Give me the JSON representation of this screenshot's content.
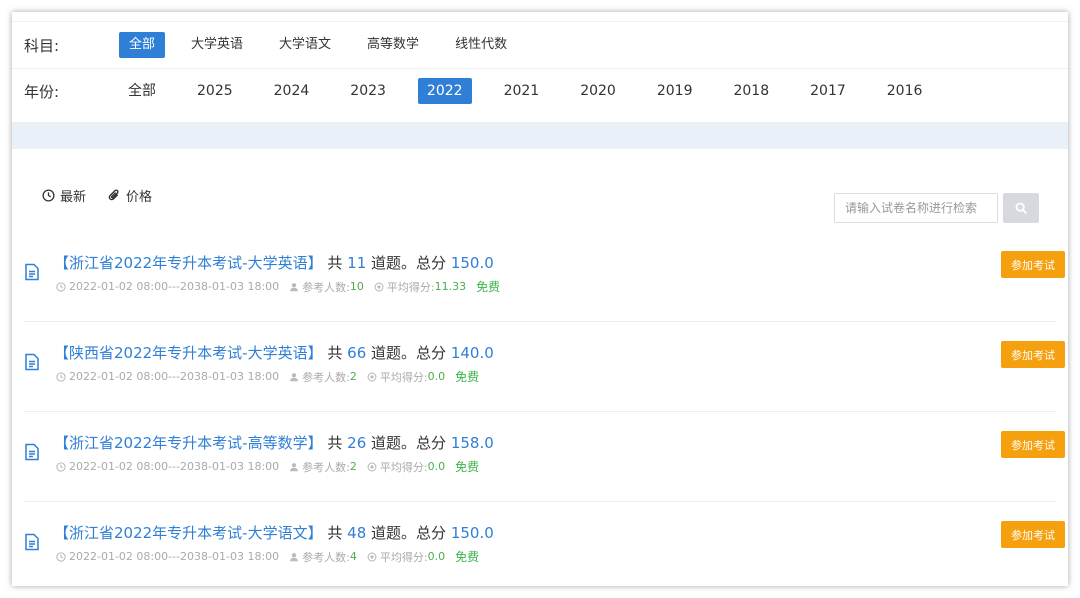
{
  "filters": {
    "subject": {
      "label": "科目:",
      "options": [
        "全部",
        "大学英语",
        "大学语文",
        "高等数学",
        "线性代数"
      ],
      "active_index": 0
    },
    "year": {
      "label": "年份:",
      "options": [
        "全部",
        "2025",
        "2024",
        "2023",
        "2022",
        "2021",
        "2020",
        "2019",
        "2018",
        "2017",
        "2016"
      ],
      "active_index": 4
    }
  },
  "sort": {
    "newest": "最新",
    "price": "价格"
  },
  "search": {
    "placeholder": "请输入试卷名称进行检索"
  },
  "exams": [
    {
      "title": "【浙江省2022年专升本考试-大学英语】",
      "gong": "共",
      "count": "11",
      "count_suffix": "道题。总分",
      "score": "150.0",
      "time": "2022-01-02 08:00---2038-01-03 18:00",
      "participants_label": "参考人数:",
      "participants": "10",
      "avg_label": "平均得分:",
      "avg": "11.33",
      "price": "免费",
      "button": "参加考试"
    },
    {
      "title": "【陕西省2022年专升本考试-大学英语】",
      "gong": "共",
      "count": "66",
      "count_suffix": "道题。总分",
      "score": "140.0",
      "time": "2022-01-02 08:00---2038-01-03 18:00",
      "participants_label": "参考人数:",
      "participants": "2",
      "avg_label": "平均得分:",
      "avg": "0.0",
      "price": "免费",
      "button": "参加考试"
    },
    {
      "title": "【浙江省2022年专升本考试-高等数学】",
      "gong": "共",
      "count": "26",
      "count_suffix": "道题。总分",
      "score": "158.0",
      "time": "2022-01-02 08:00---2038-01-03 18:00",
      "participants_label": "参考人数:",
      "participants": "2",
      "avg_label": "平均得分:",
      "avg": "0.0",
      "price": "免费",
      "button": "参加考试"
    },
    {
      "title": "【浙江省2022年专升本考试-大学语文】",
      "gong": "共",
      "count": "48",
      "count_suffix": "道题。总分",
      "score": "150.0",
      "time": "2022-01-02 08:00---2038-01-03 18:00",
      "participants_label": "参考人数:",
      "participants": "4",
      "avg_label": "平均得分:",
      "avg": "0.0",
      "price": "免费",
      "button": "参加考试"
    }
  ],
  "colors": {
    "accent": "#2f7fd6",
    "button": "#f5a00f",
    "free": "#3bb54a"
  }
}
